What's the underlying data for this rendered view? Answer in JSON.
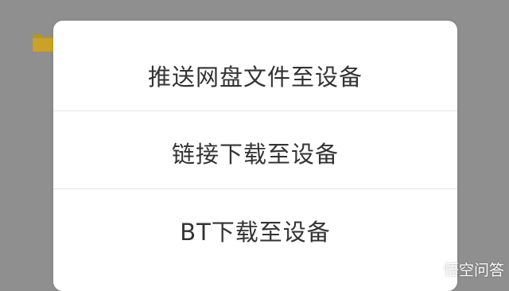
{
  "menu": {
    "items": [
      {
        "label": "推送网盘文件至设备"
      },
      {
        "label": "链接下载至设备"
      },
      {
        "label": "BT下载至设备"
      }
    ]
  },
  "background": {
    "icon": "folder-icon"
  },
  "watermark": {
    "text": "悟空问答",
    "icon": "wukong-logo-icon"
  },
  "colors": {
    "overlay": "#8f8f8f",
    "sheet": "#ffffff",
    "text": "#333333",
    "divider": "#e4e4e4",
    "folder": "#c9a227"
  }
}
